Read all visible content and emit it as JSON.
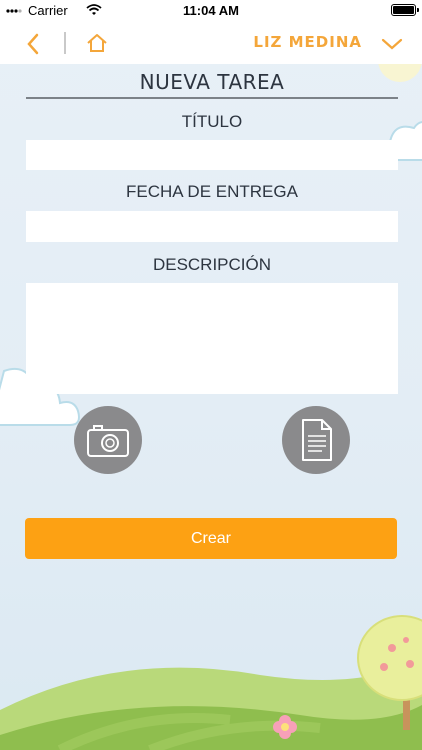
{
  "status_bar": {
    "carrier": "Carrier",
    "time": "11:04 AM"
  },
  "nav": {
    "user_name": "LIZ MEDINA"
  },
  "form": {
    "title": "NUEVA TAREA",
    "title_label": "TÍTULO",
    "title_value": "",
    "due_date_label": "FECHA DE ENTREGA",
    "due_date_value": "",
    "description_label": "DESCRIPCIÓN",
    "description_value": ""
  },
  "actions": {
    "camera_icon": "camera-icon",
    "document_icon": "document-icon",
    "create_label": "Crear"
  },
  "colors": {
    "accent": "#fda113",
    "user_name": "#f4a63a",
    "circle_button": "#8a8a8c"
  }
}
